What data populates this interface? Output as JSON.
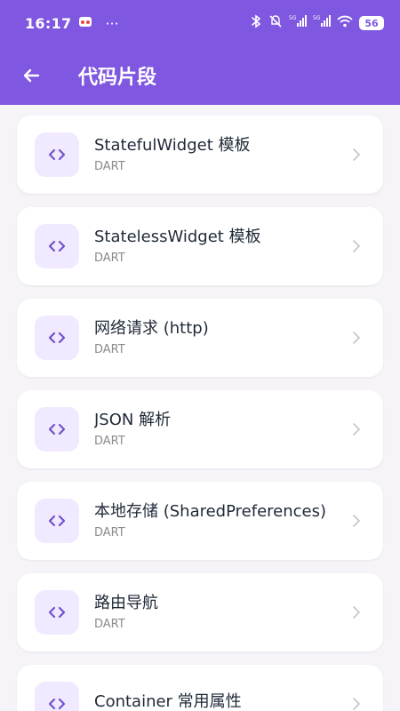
{
  "status": {
    "time": "16:17",
    "dots": "···",
    "battery": "56"
  },
  "toolbar": {
    "title": "代码片段"
  },
  "snippets": [
    {
      "title": "StatefulWidget 模板",
      "lang": "DART"
    },
    {
      "title": "StatelessWidget 模板",
      "lang": "DART"
    },
    {
      "title": "网络请求 (http)",
      "lang": "DART"
    },
    {
      "title": "JSON 解析",
      "lang": "DART"
    },
    {
      "title": "本地存储 (SharedPreferences)",
      "lang": "DART"
    },
    {
      "title": "路由导航",
      "lang": "DART"
    },
    {
      "title": "Container 常用属性",
      "lang": ""
    }
  ],
  "icons": {
    "back": "arrow-left-icon",
    "code": "code-brackets-icon",
    "chevron": "chevron-right-icon"
  },
  "colors": {
    "primary": "#7f57e0",
    "badge_bg": "#f0e9ff"
  }
}
